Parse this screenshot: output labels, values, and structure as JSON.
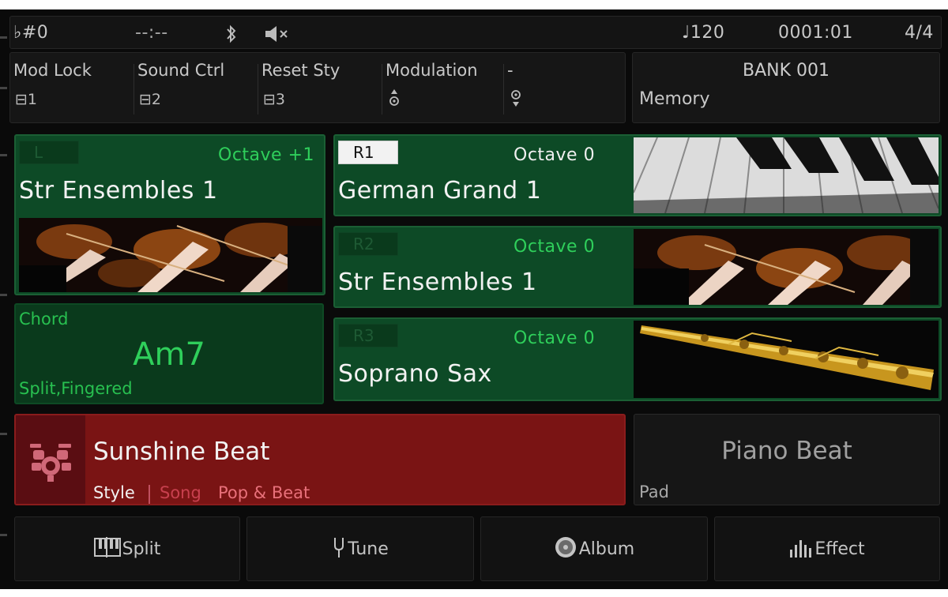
{
  "status": {
    "transpose": "♭#0",
    "time": "--:--",
    "tempo": "♩120",
    "measure": "0001:01",
    "time_signature": "4/4"
  },
  "functions": [
    {
      "label": "Mod Lock",
      "sub": "⊟1"
    },
    {
      "label": "Sound Ctrl",
      "sub": "⊟2"
    },
    {
      "label": "Reset Sty",
      "sub": "⊟3"
    },
    {
      "label": "Modulation",
      "sub": ""
    },
    {
      "label": "-",
      "sub": ""
    }
  ],
  "bank": {
    "title": "BANK 001",
    "label": "Memory"
  },
  "voices": {
    "left": {
      "tag": "L",
      "octave": "Octave +1",
      "name": "Str Ensembles 1",
      "active": false,
      "image": "violin-players-photo"
    },
    "r1": {
      "tag": "R1",
      "octave": "Octave 0",
      "name": "German Grand 1",
      "active": true,
      "image": "piano-keys-photo"
    },
    "r2": {
      "tag": "R2",
      "octave": "Octave 0",
      "name": "Str Ensembles 1",
      "active": false,
      "image": "violin-players-photo"
    },
    "r3": {
      "tag": "R3",
      "octave": "Octave 0",
      "name": "Soprano Sax",
      "active": false,
      "image": "soprano-sax-photo"
    }
  },
  "chord": {
    "label": "Chord",
    "value": "Am7",
    "mode": "Split,Fingered"
  },
  "style": {
    "name": "Sunshine Beat",
    "tab_style": "Style",
    "tab_song": "Song",
    "category": "Pop & Beat",
    "icon": "drum-kit-icon"
  },
  "pad": {
    "name": "Piano Beat",
    "label": "Pad"
  },
  "buttons": [
    {
      "label": "Split",
      "icon": "keyboard-split-icon"
    },
    {
      "label": "Tune",
      "icon": "tuning-fork-icon"
    },
    {
      "label": "Album",
      "icon": "album-disc-icon"
    },
    {
      "label": "Effect",
      "icon": "effect-bars-icon"
    }
  ],
  "colors": {
    "voice_panel": "#0d4a26",
    "accent_green": "#2fcf5b",
    "style_red": "#7a1414",
    "song_pink": "#e0606a"
  }
}
